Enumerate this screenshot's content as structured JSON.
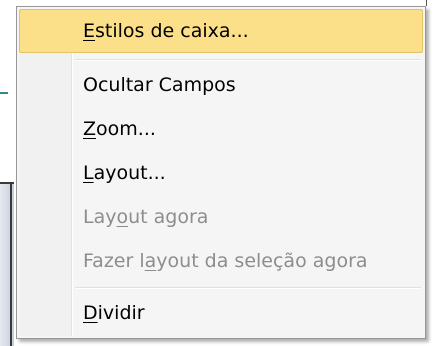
{
  "menu": {
    "items": [
      {
        "pre": "",
        "key": "E",
        "post": "stilos de caixa...",
        "state": "highlighted"
      },
      {
        "pre": "Ocultar Campos",
        "key": "",
        "post": "",
        "state": "enabled"
      },
      {
        "pre": "",
        "key": "Z",
        "post": "oom...",
        "state": "enabled"
      },
      {
        "pre": "",
        "key": "L",
        "post": "ayout...",
        "state": "enabled"
      },
      {
        "pre": "Lay",
        "key": "o",
        "post": "ut agora",
        "state": "disabled"
      },
      {
        "pre": "Fazer l",
        "key": "a",
        "post": "yout da seleção agora",
        "state": "disabled"
      },
      {
        "pre": "",
        "key": "D",
        "post": "ividir",
        "state": "enabled"
      }
    ]
  },
  "colors": {
    "highlight": "#fbdf89",
    "highlight_border": "#e5c365",
    "menu_background": "#f5f5f5",
    "disabled_text": "#8d8d8d"
  }
}
